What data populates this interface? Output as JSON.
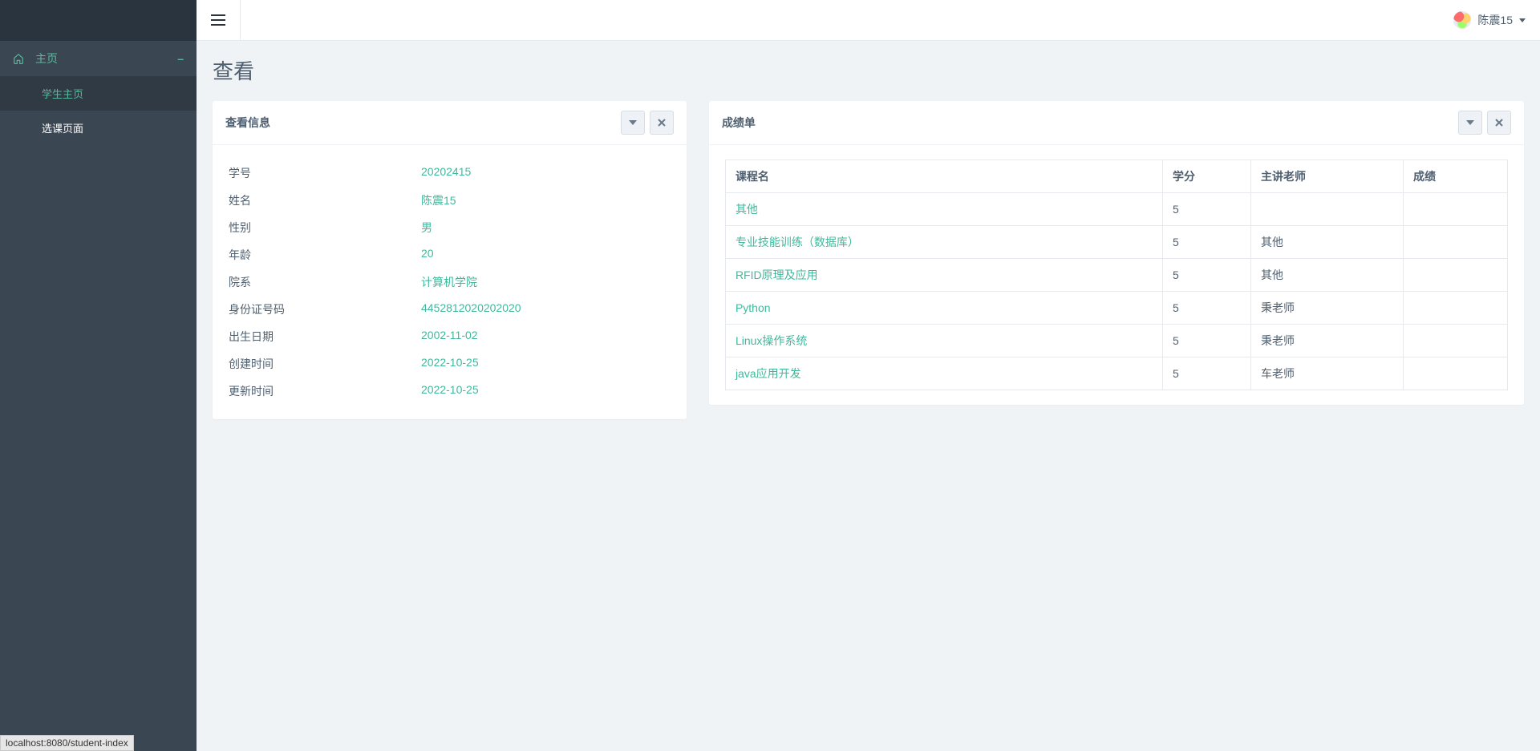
{
  "sidebar": {
    "top_label": "主页",
    "collapse_mark": "–",
    "items": [
      {
        "label": "学生主页"
      },
      {
        "label": "选课页面"
      }
    ]
  },
  "topbar": {
    "username": "陈震15"
  },
  "page": {
    "title": "查看"
  },
  "info_card": {
    "title": "查看信息",
    "rows": [
      {
        "label": "学号",
        "value": "20202415"
      },
      {
        "label": "姓名",
        "value": "陈震15"
      },
      {
        "label": "性别",
        "value": "男"
      },
      {
        "label": "年龄",
        "value": "20"
      },
      {
        "label": "院系",
        "value": "计算机学院"
      },
      {
        "label": "身份证号码",
        "value": "4452812020202020"
      },
      {
        "label": "出生日期",
        "value": "2002-11-02"
      },
      {
        "label": "创建时间",
        "value": "2022-10-25"
      },
      {
        "label": "更新时间",
        "value": "2022-10-25"
      }
    ]
  },
  "grades_card": {
    "title": "成绩单",
    "headers": [
      "课程名",
      "学分",
      "主讲老师",
      "成绩"
    ],
    "rows": [
      {
        "course": "其他",
        "credit": "5",
        "teacher": "",
        "grade": ""
      },
      {
        "course": "专业技能训练（数据库）",
        "credit": "5",
        "teacher": "其他",
        "grade": ""
      },
      {
        "course": "RFID原理及应用",
        "credit": "5",
        "teacher": "其他",
        "grade": ""
      },
      {
        "course": "Python",
        "credit": "5",
        "teacher": "秉老师",
        "grade": ""
      },
      {
        "course": "Linux操作系统",
        "credit": "5",
        "teacher": "秉老师",
        "grade": ""
      },
      {
        "course": "java应用开发",
        "credit": "5",
        "teacher": "车老师",
        "grade": ""
      }
    ]
  },
  "status_bar": "localhost:8080/student-index"
}
